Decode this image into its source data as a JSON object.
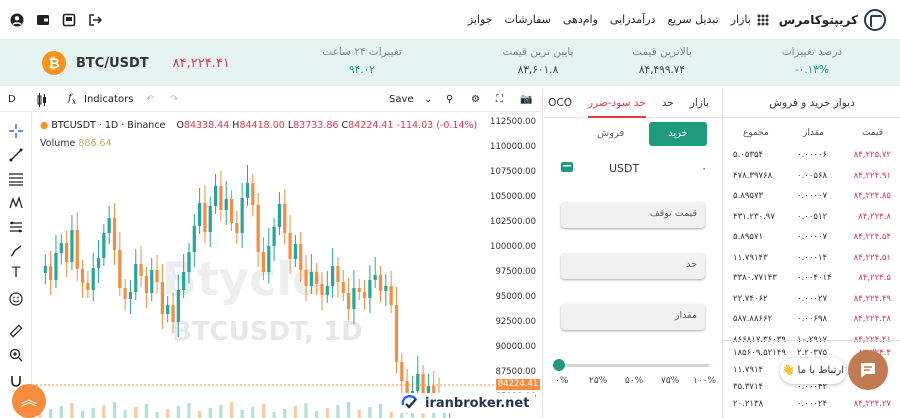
{
  "brand": {
    "name": "کریپتوکامرس"
  },
  "nav": {
    "items": [
      "بازار",
      "تبدیل سریع",
      "درآمدزایی",
      "وام‌دهی",
      "سفارشات",
      "جوایز"
    ]
  },
  "stats": {
    "pair": "BTC/USDT",
    "price": "۸۴,۲۲۴.۴۱",
    "change_pct_label": "درصد تغییرات",
    "change_pct_value": "-۰.۱۳%",
    "high_label": "بالاترین قیمت",
    "high_value": "۸۴,۴۹۹.۷۴",
    "low_label": "پایین ترین قیمت",
    "low_value": "۸۳,۶۰۱.۸",
    "change24_label": "تغییرات ۲۴ ساعت",
    "change24_value": "۹۴.۰۲"
  },
  "chart_toolbar": {
    "interval": "D",
    "indicators": "Indicators",
    "save": "Save"
  },
  "chart_legend": {
    "symbol": "BTCUSDT · 1D · Binance",
    "o": "84338.44",
    "h": "84418.00",
    "l": "83733.86",
    "c": "84224.41",
    "change": "-114.03 (-0.14%)",
    "volume_label": "Volume",
    "volume_value": "886.64",
    "watermark": "BTCUSDT, 1D",
    "watermark_brand": "Btyclo",
    "price_tag": "84224.41"
  },
  "chart_data": {
    "type": "candlestick",
    "yticks": [
      "112500.00",
      "110000.00",
      "107500.00",
      "105000.00",
      "102500.00",
      "100000.00",
      "97500.00",
      "95000.00",
      "92500.00",
      "90000.00",
      "87500.00",
      "85000.00"
    ],
    "ylim": [
      83000,
      113600
    ]
  },
  "trade": {
    "tabs": [
      "بازار",
      "حد",
      "حد سود-ضرر",
      "OCO"
    ],
    "buy": "خرید",
    "sell": "فروش",
    "asset": "USDT",
    "balance": "۰",
    "stop_price": "قیمت توقف",
    "limit": "حد",
    "amount": "مقدار",
    "pcts": [
      "۰%",
      "۲۵%",
      "۵۰%",
      "۷۵%",
      "۱۰۰%"
    ]
  },
  "book": {
    "title": "دیوار خرید و فروش",
    "headers": {
      "price": "قیمت",
      "amount": "مقدار",
      "total": "مجموع"
    },
    "rows": [
      {
        "p": "۸۴,۲۲۵.۷۲",
        "a": "۰.۰۰۰۰۶",
        "t": "۵.۰۵۳۵۴"
      },
      {
        "p": "۸۴,۲۲۴.۹۱",
        "a": "۰.۰۰۵۶۸",
        "t": "۴۷۸.۳۹۷۶۸"
      },
      {
        "p": "۸۴,۲۲۴.۸۵",
        "a": "۰.۰۰۰۰۷",
        "t": "۵.۸۹۵۷۳"
      },
      {
        "p": "۸۴,۲۲۴.۸",
        "a": "۰.۰۰۵۱۲",
        "t": "۴۳۱.۲۳۰.۹۷"
      },
      {
        "p": "۸۴,۲۲۴.۵۴",
        "a": "۰.۰۰۰۰۷",
        "t": "۵.۸۹۵۷۱"
      },
      {
        "p": "۸۴,۲۲۴.۵۱",
        "a": "۰.۰۰۰۱۴",
        "t": "۱۱.۷۹۱۴۳"
      },
      {
        "p": "۸۴,۲۲۴.۵",
        "a": "۰.۰۰۴۰۱۴",
        "t": "۳۳۸۰.۷۷۱۴۳"
      },
      {
        "p": "۸۴,۲۲۴.۴۹",
        "a": "۰.۰۰۰۲۷",
        "t": "۲۲.۷۴۰۶۲"
      },
      {
        "p": "۸۴,۲۲۴.۴۸",
        "a": "۰.۰۰۶۹۸",
        "t": "۵۸۷.۸۸۶۶۲"
      },
      {
        "p": "۸۴,۲۲۴.۴۱",
        "a": "۱۰.۲۹۱۷",
        "t": "۸۶۶۸۱۷.۳۶۰۳۹"
      }
    ],
    "rows2": [
      {
        "p": "۸۴,۲۲۴.۴",
        "a": "۲.۲۰۳۷۵",
        "t": "۱۸۵۶۰۹.۵۲۱۴۹"
      },
      {
        "p": "",
        "a": "۰.۰۰۰۱۴",
        "t": "۱۱.۷۹۱۴"
      },
      {
        "p": "",
        "a": "۰.۰۰۰۴۲",
        "t": "۳۵.۳۷۱۴"
      },
      {
        "p": "۸۴,۲۲۴.۲۷",
        "a": "۰.۰۰۰۲۴",
        "t": "۲۰.۲۱۳۸"
      }
    ]
  },
  "widgets": {
    "contact": "ارتباط با ما",
    "ib_logo": "iranbroker.net"
  }
}
